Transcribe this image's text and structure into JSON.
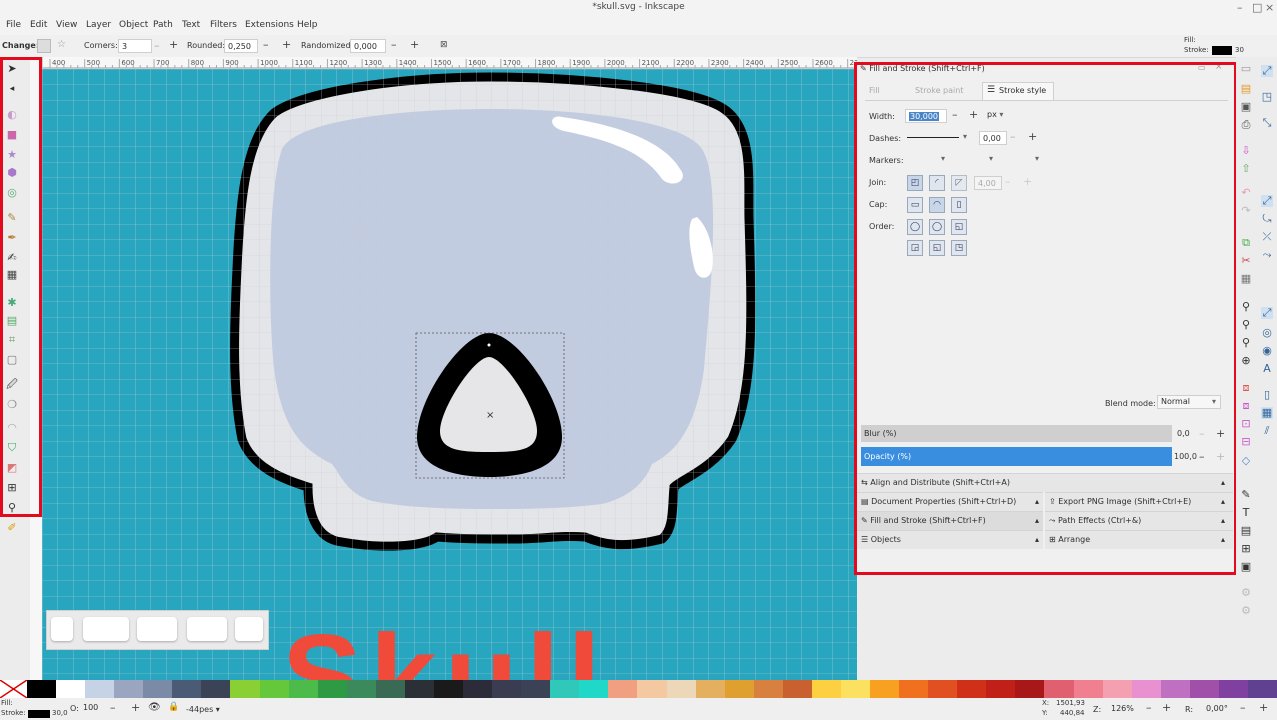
{
  "window": {
    "title": "*skull.svg - Inkscape"
  },
  "menu": [
    "File",
    "Edit",
    "View",
    "Layer",
    "Object",
    "Path",
    "Text",
    "Filters",
    "Extensions",
    "Help"
  ],
  "toolctrl": {
    "change_label": "Change:",
    "corners_label": "Corners:",
    "corners_value": "3",
    "rounded_label": "Rounded:",
    "rounded_value": "0,250",
    "randomized_label": "Randomized:",
    "randomized_value": "0,000"
  },
  "style_indicator": {
    "fill_label": "Fill:",
    "stroke_label": "Stroke:",
    "stroke_width": "30"
  },
  "ruler_top_labels": [
    "400",
    "500",
    "600",
    "700",
    "800",
    "900",
    "1000",
    "1100",
    "1200",
    "1300",
    "1400",
    "1500",
    "1600",
    "1700",
    "1800",
    "1900",
    "2000",
    "2100",
    "2200",
    "2300",
    "2400",
    "2500",
    "2600",
    "2700"
  ],
  "canvas": {
    "text": "Skull",
    "text_color": "#f04a3a",
    "bg_color": "#29a6bf"
  },
  "fill_stroke": {
    "header": "Fill and Stroke (Shift+Ctrl+F)",
    "tabs": [
      "Fill",
      "Stroke paint",
      "Stroke style"
    ],
    "width_label": "Width:",
    "width_value": "30,000",
    "width_unit": "px",
    "dashes_label": "Dashes:",
    "dashes_value": "0,00",
    "markers_label": "Markers:",
    "join_label": "Join:",
    "join_value": "4,00",
    "cap_label": "Cap:",
    "order_label": "Order:",
    "blend_label": "Blend mode:",
    "blend_value": "Normal",
    "blur_label": "Blur (%)",
    "blur_value": "0,0",
    "blur_percent": 0,
    "opacity_label": "Opacity (%)",
    "opacity_value": "100,0",
    "opacity_percent": 100
  },
  "dock": {
    "align": "Align and Distribute (Shift+Ctrl+A)",
    "doc_props": "Document Properties (Shift+Ctrl+D)",
    "export_png": "Export PNG Image (Shift+Ctrl+E)",
    "fill_stroke": "Fill and Stroke (Shift+Ctrl+F)",
    "path_effects": "Path Effects (Ctrl+&)",
    "objects": "Objects",
    "arrange": "Arrange"
  },
  "palette_colors": [
    "#000000",
    "#ffffff",
    "#c6d2e6",
    "#9aa5c0",
    "#7b8aa6",
    "#4b5b75",
    "#3a4456",
    "#8ad034",
    "#64c83a",
    "#4cbb4a",
    "#2e9a44",
    "#3a8a5c",
    "#3a6a54",
    "#2a3036",
    "#1a1a1a",
    "#2b2b3a",
    "#3a3c52",
    "#3c4256",
    "#30c8b8",
    "#20d8c8",
    "#f0a080",
    "#f4c8a0",
    "#ecd8b8",
    "#e4b060",
    "#e0a030",
    "#d88040",
    "#c86030",
    "#fcd040",
    "#fce060",
    "#f8a020",
    "#f07020",
    "#e05020",
    "#d03018",
    "#c02018",
    "#a81818",
    "#e06070",
    "#f08090",
    "#f4a0b0",
    "#e890d0",
    "#c070c0",
    "#a050a8",
    "#8040a0",
    "#604090"
  ],
  "status": {
    "fill_label": "Fill:",
    "stroke_label": "Stroke:",
    "stroke_w": "30,0",
    "o_label": "O:",
    "opacity": "100",
    "layer": "-44pes",
    "x_label": "X:",
    "x": "1501,93",
    "y_label": "Y:",
    "y": "440,84",
    "z_label": "Z:",
    "zoom": "126%",
    "r_label": "R:",
    "rotation": "0,00°"
  }
}
